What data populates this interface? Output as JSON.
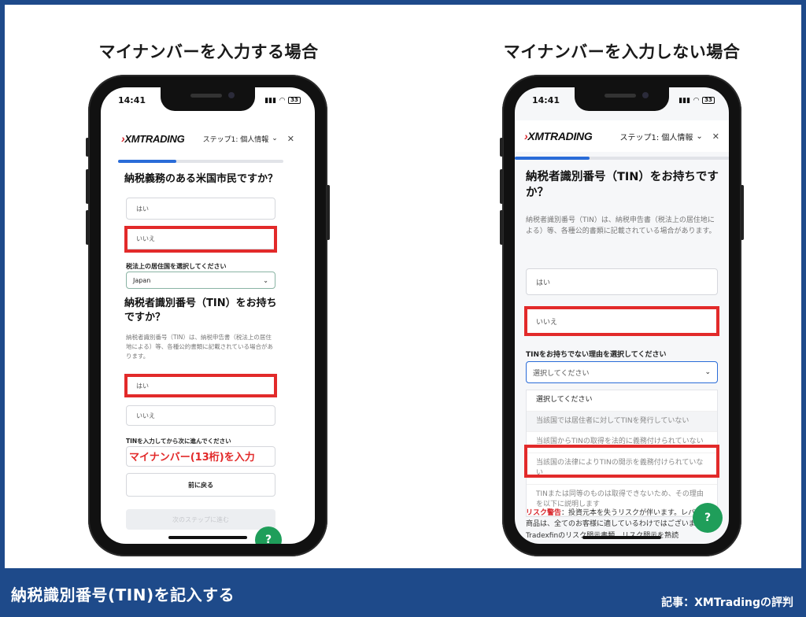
{
  "left": {
    "title": "マイナンバーを入力する場合",
    "time": "14:41",
    "logo": "XMTRADING",
    "step": "ステップ1: 個人情報",
    "q1": "納税義務のある米国市民ですか？",
    "yes": "はい",
    "no": "いいえ",
    "country_label": "税法上の居住国を選択してください",
    "country_value": "Japan",
    "q2": "納税者識別番号（TIN）をお持ちですか？",
    "desc": "納税者識別番号（TIN）は、納税申告書（税法上の居住地による）等、各種公的書類に記載されている場合があります。",
    "tin_label": "TINを入力してから次に進んでください",
    "annotation": "マイナンバー(13桁)を入力",
    "back": "前に戻る",
    "next": "次のステップに進む",
    "progress": 0.35
  },
  "right": {
    "title": "マイナンバーを入力しない場合",
    "time": "14:41",
    "logo": "XMTRADING",
    "step": "ステップ1: 個人情報",
    "q2": "納税者識別番号（TIN）をお持ちですか？",
    "desc": "納税者識別番号（TIN）は、納税申告書（税法上の居住地による）等、各種公的書類に記載されている場合があります。",
    "yes": "はい",
    "no": "いいえ",
    "reason_label": "TINをお持ちでない理由を選択してください",
    "select_placeholder": "選択してください",
    "options": [
      "選択してください",
      "当該国では居住者に対してTINを発行していない",
      "当該国からTINの取得を法的に義務付けられていない",
      "当該国の法律によりTINの開示を義務付けられていない",
      "TINまたは同等のものは取得できないため、その理由を以下に説明します"
    ],
    "risk_title": "リスク警告",
    "risk_text": "：投資元本を失うリスクが伴います。レバレッジ商品は、全てのお客様に適しているわけではございません。Tradexfinのリスク開示書類、リスク開示を熟読",
    "progress": 0.35
  },
  "footer": {
    "left": "納税識別番号(TIN)を記入する",
    "right": "記事：XMTradingの評判"
  },
  "colors": {
    "accent_blue": "#1e4a8a",
    "highlight_red": "#e22a2a",
    "progress_blue": "#2a6cd8",
    "help_green": "#1f9e5a"
  }
}
